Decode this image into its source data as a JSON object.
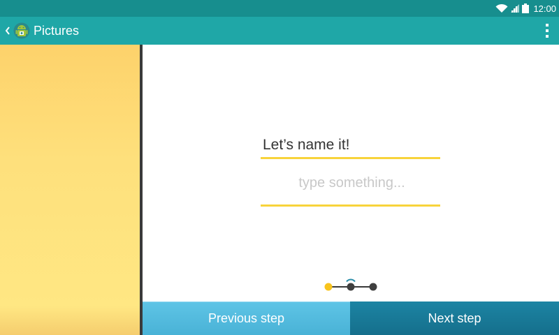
{
  "status_bar": {
    "time": "12:00",
    "icons": [
      "wifi-icon",
      "signal-icon",
      "battery-icon"
    ]
  },
  "app_bar": {
    "title": "Pictures",
    "icons": [
      "back-chevron-icon",
      "android-app-icon",
      "overflow-menu-icon"
    ]
  },
  "main": {
    "prompt": "Let’s name it!",
    "name_input": {
      "value": "",
      "placeholder": "type something..."
    },
    "stepper": {
      "total_steps": 3,
      "current_step": 1
    }
  },
  "footer": {
    "previous_label": "Previous step",
    "next_label": "Next step"
  },
  "colors": {
    "status_bar": "#178e8e",
    "app_bar": "#1fa7a7",
    "accent_yellow": "#f8d33b",
    "previous_button": "#49b2d6",
    "next_button": "#156f8c"
  }
}
